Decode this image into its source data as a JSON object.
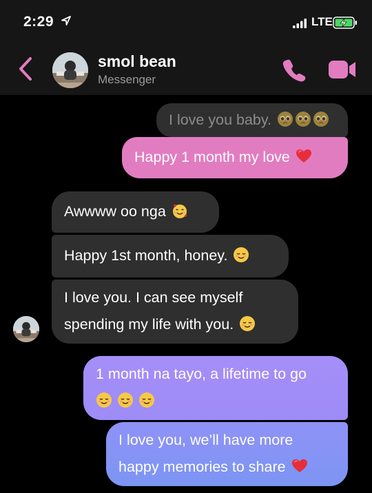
{
  "status_bar": {
    "time": "2:29",
    "network": "LTE"
  },
  "header": {
    "contact_name": "smol bean",
    "subtitle": "Messenger"
  },
  "messages": [
    {
      "text": "I love you baby.",
      "emoji": [
        "pleading-face",
        "pleading-face",
        "pleading-face"
      ],
      "sender": "me"
    },
    {
      "text": "Happy 1 month my love",
      "emoji": [
        "red-heart"
      ],
      "sender": "me"
    },
    {
      "text": "Awwww oo nga",
      "emoji": [
        "smiling-face-with-hearts"
      ],
      "sender": "contact"
    },
    {
      "text": "Happy 1st month, honey.",
      "emoji": [
        "relieved-face"
      ],
      "sender": "contact"
    },
    {
      "line1": "I love you. I can see myself",
      "line2": "spending my life with you.",
      "emoji": [
        "relieved-face"
      ],
      "sender": "contact"
    },
    {
      "line1": "1 month na tayo, a lifetime to go",
      "emoji": [
        "relieved-face",
        "relieved-face",
        "relieved-face"
      ],
      "sender": "me"
    },
    {
      "line1": "I love you, we’ll have more",
      "line2": "happy memories to share",
      "emoji": [
        "red-heart"
      ],
      "sender": "me"
    }
  ],
  "colors": {
    "accent_pink": "#e27cc1",
    "bubble_gray": "#2f2f2f",
    "bubble_purple": "#a58ef7",
    "bubble_blue": "#7c95f4",
    "header_bg": "#161616"
  }
}
